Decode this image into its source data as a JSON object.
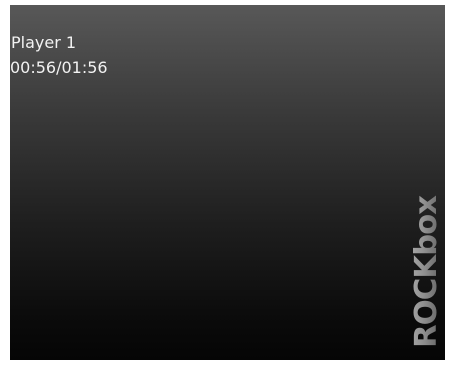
{
  "player": {
    "track_title": "Player 1",
    "time_readout": "00:56/01:56",
    "elapsed": "00:56",
    "duration": "01:56"
  },
  "logo": {
    "text": "ROCKbox",
    "icon": "rockbox-logo-icon",
    "color": "#9a9a9a"
  },
  "colors": {
    "screen_top": "#585858",
    "screen_bottom": "#050505",
    "text": "#f2f2f2"
  }
}
